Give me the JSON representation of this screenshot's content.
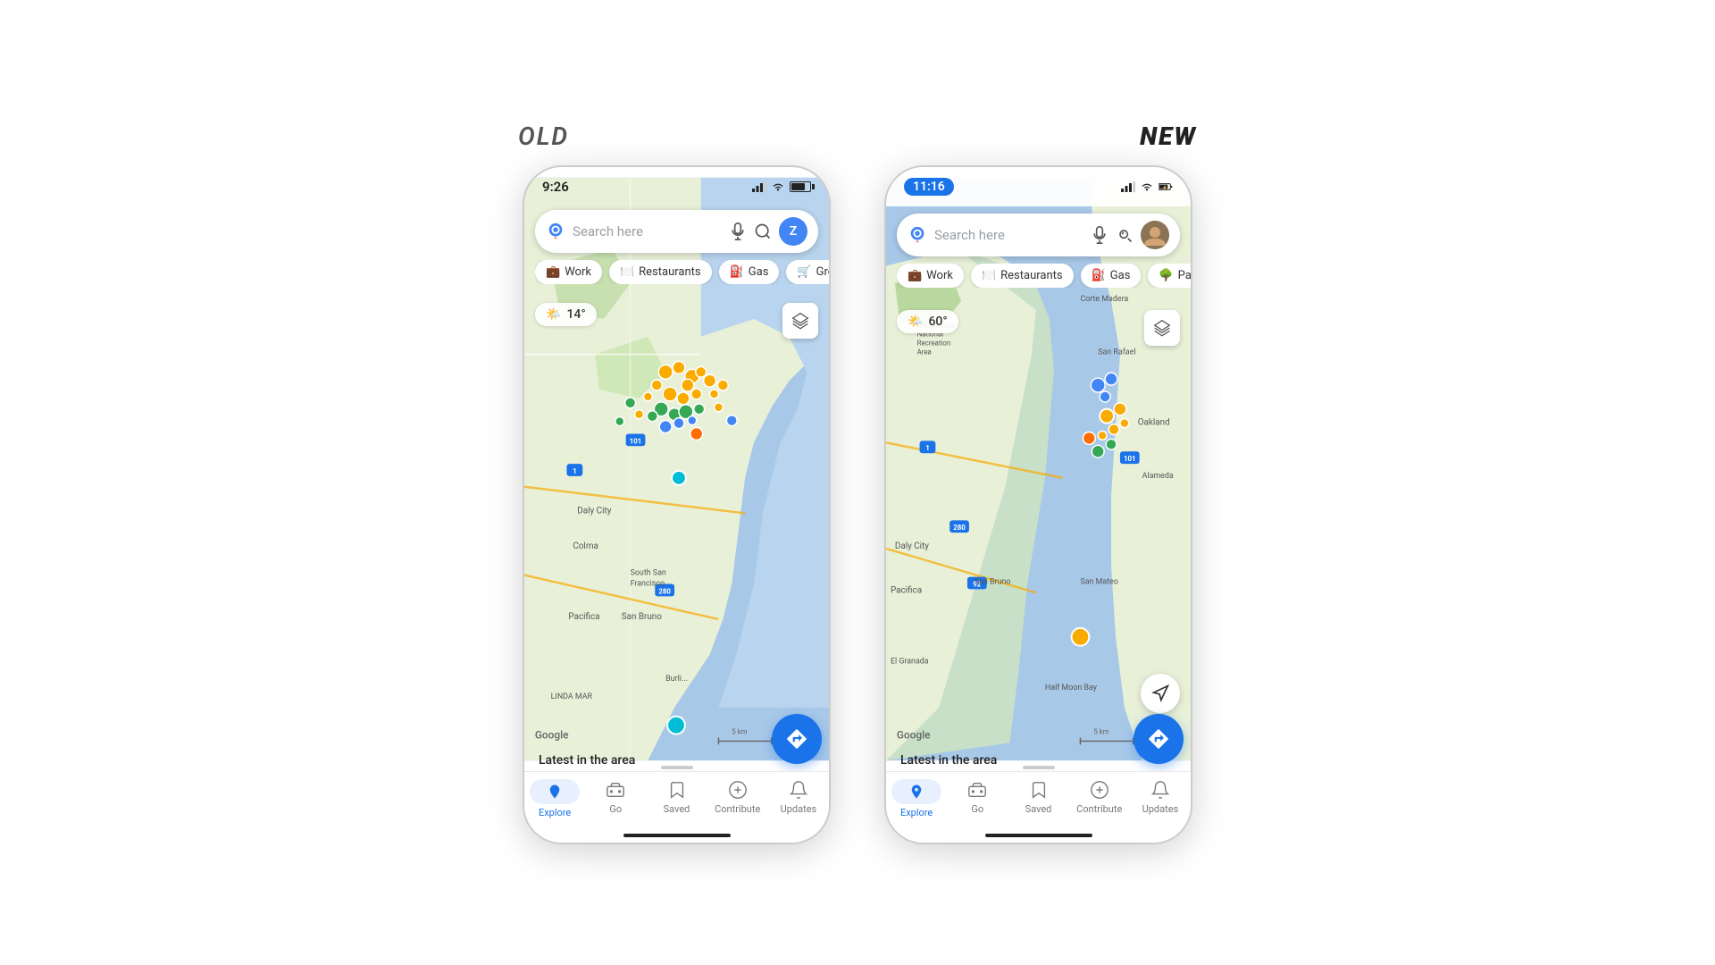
{
  "labels": {
    "old": "OLD",
    "new": "NEW"
  },
  "old_phone": {
    "status": {
      "time": "9:26",
      "signal": "▲",
      "wifi": "wifi",
      "battery": "70"
    },
    "search": {
      "placeholder": "Search here",
      "mic": "mic",
      "lens": "lens",
      "avatar_initial": "Z"
    },
    "categories": [
      "Work",
      "Restaurants",
      "Gas",
      "Groceries"
    ],
    "category_icons": [
      "💼",
      "🍽️",
      "⛽",
      "🛒"
    ],
    "weather": "14°",
    "weather_icon": "🌤️",
    "nav_items": [
      "Explore",
      "Go",
      "Saved",
      "Contribute",
      "Updates"
    ],
    "nav_icons": [
      "📍",
      "🚗",
      "🔖",
      "➕",
      "🔔"
    ],
    "google_logo": "Google",
    "latest": "Latest in the area",
    "scale": "5 km"
  },
  "new_phone": {
    "status": {
      "time": "11:16",
      "signal": "signal",
      "wifi": "wifi",
      "battery": "charging"
    },
    "search": {
      "placeholder": "Search here",
      "mic": "mic",
      "lens": "lens",
      "avatar": "person"
    },
    "categories": [
      "Work",
      "Restaurants",
      "Gas",
      "Parks"
    ],
    "category_icons": [
      "💼",
      "🍽️",
      "⛽",
      "🌳"
    ],
    "weather": "60°",
    "weather_icon": "🌤️",
    "nav_items": [
      "Explore",
      "Go",
      "Saved",
      "Contribute",
      "Updates"
    ],
    "nav_icons": [
      "📍",
      "🚗",
      "🔖",
      "➕",
      "🔔"
    ],
    "google_logo": "Google",
    "latest": "Latest in the area",
    "scale": "5 km"
  }
}
